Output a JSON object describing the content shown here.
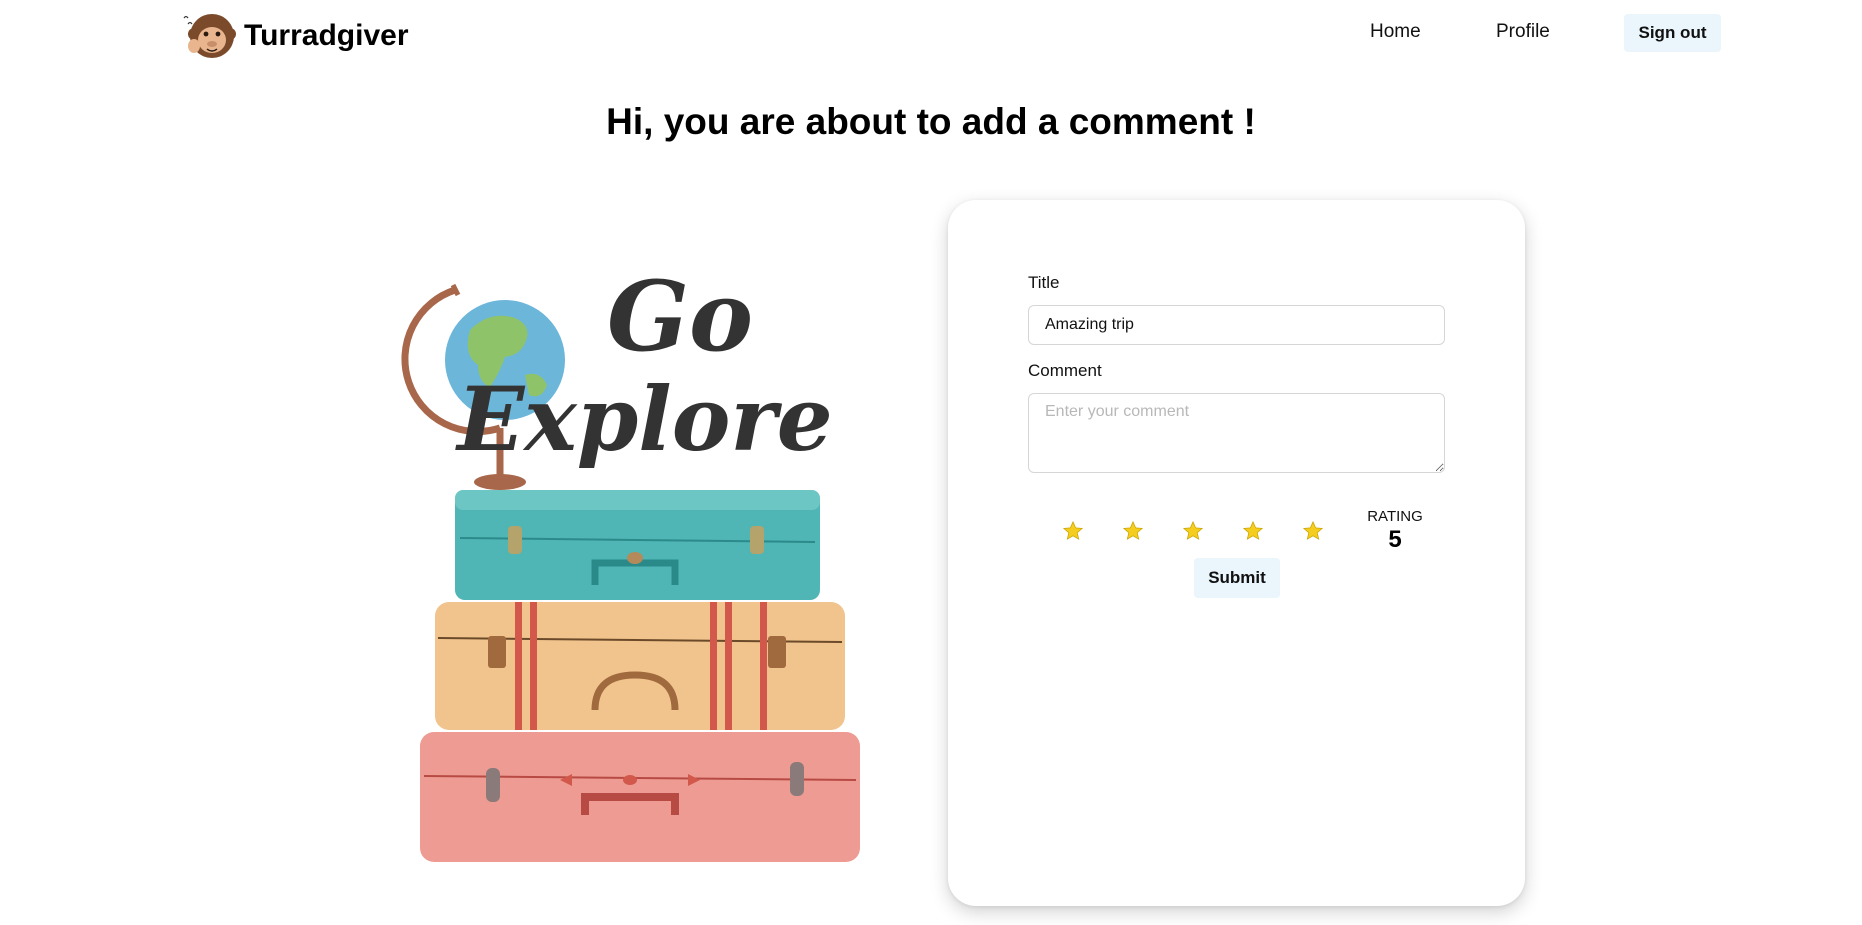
{
  "header": {
    "brand_name": "Turradgiver",
    "nav": {
      "home": "Home",
      "profile": "Profile",
      "sign_out": "Sign out"
    }
  },
  "page": {
    "title": "Hi, you are about to add a comment !"
  },
  "illustration": {
    "headline_line1": "Go",
    "headline_line2": "Explore",
    "colors": {
      "suitcase_top": "#4fb5b5",
      "suitcase_mid": "#f2c48d",
      "suitcase_bottom": "#ee9c93",
      "globe": "#6cb6da"
    }
  },
  "form": {
    "title_label": "Title",
    "title_value": "Amazing trip",
    "comment_label": "Comment",
    "comment_placeholder": "Enter your comment",
    "rating_label": "RATING",
    "rating_value": "5",
    "star_count": 5,
    "star_color": "#f5cd1f",
    "submit_label": "Submit"
  },
  "colors": {
    "button_bg": "#eaf5fc"
  }
}
